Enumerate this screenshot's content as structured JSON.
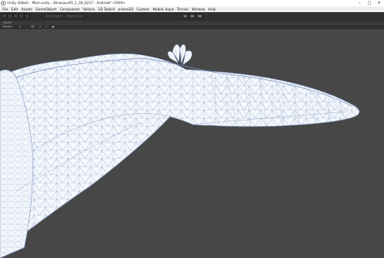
{
  "window": {
    "title": "Unity (64bit) - Main.unity - DinosaurAR_1_30_0217 - Android* <DX9>",
    "minimize_icon": "minimize-icon",
    "maximize_icon": "maximize-icon",
    "close_icon": "close-icon"
  },
  "menu": {
    "items": [
      "File",
      "Edit",
      "Assets",
      "GameObject",
      "Component",
      "Vuforia",
      "2D Toolkit",
      "anime2D",
      "Custom",
      "Mobile Input",
      "Terrain",
      "Window",
      "Help"
    ]
  },
  "scene": {
    "tab_label": "Scene",
    "shading_mode": "Shaded",
    "mode_2d": "2D"
  },
  "colors": {
    "background": "#474747",
    "mesh_fill": "#f4f7fb",
    "mesh_edge": "#8ba0c8"
  }
}
